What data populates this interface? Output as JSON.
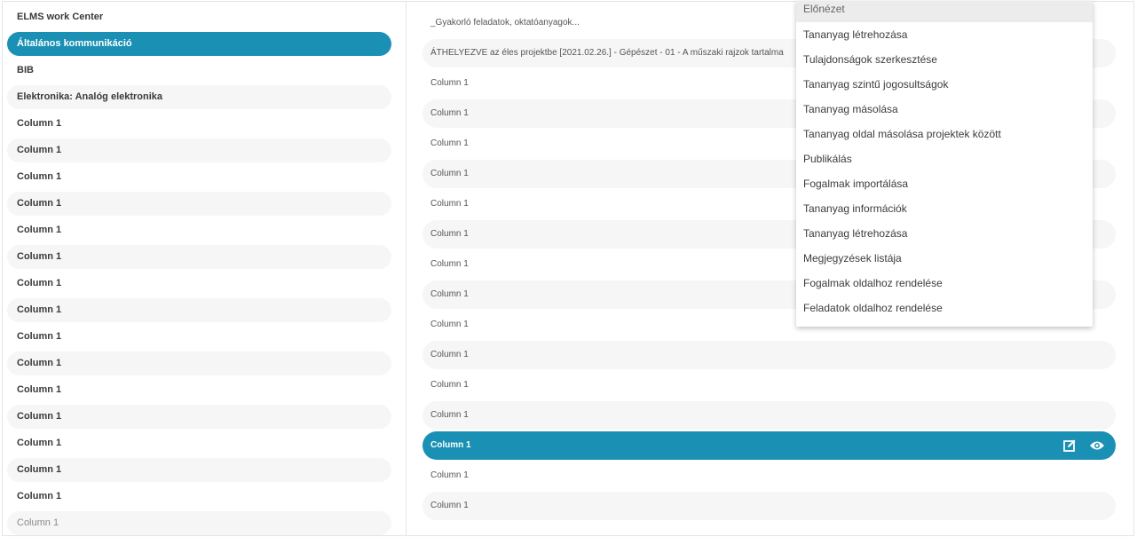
{
  "left_list": {
    "items": [
      {
        "label": "ELMS work Center",
        "style": "bold"
      },
      {
        "label": "Általános kommunikáció",
        "style": "selected"
      },
      {
        "label": "BIB",
        "style": "bold"
      },
      {
        "label": "Elektronika: Analóg elektronika",
        "style": "bold alt"
      },
      {
        "label": "Column 1",
        "style": "bold"
      },
      {
        "label": "Column 1",
        "style": "bold alt"
      },
      {
        "label": "Column 1",
        "style": "bold"
      },
      {
        "label": "Column 1",
        "style": "bold alt"
      },
      {
        "label": "Column 1",
        "style": "bold"
      },
      {
        "label": "Column 1",
        "style": "bold alt"
      },
      {
        "label": "Column 1",
        "style": "bold"
      },
      {
        "label": "Column 1",
        "style": "bold alt"
      },
      {
        "label": "Column 1",
        "style": "bold"
      },
      {
        "label": "Column 1",
        "style": "bold alt"
      },
      {
        "label": "Column 1",
        "style": "bold"
      },
      {
        "label": "Column 1",
        "style": "bold alt"
      },
      {
        "label": "Column 1",
        "style": "bold"
      },
      {
        "label": "Column 1",
        "style": "bold alt"
      },
      {
        "label": "Column 1",
        "style": "bold"
      },
      {
        "label": "Column 1",
        "style": "light alt"
      }
    ]
  },
  "right_list": {
    "items": [
      {
        "label": "_Gyakorló feladatok, oktatóanyagok...",
        "style": ""
      },
      {
        "label": "ÁTHELYEZVE az éles projektbe [2021.02.26.] - Gépészet - 01 - A műszaki rajzok tartalma",
        "style": "alt"
      },
      {
        "label": "Column 1",
        "style": ""
      },
      {
        "label": "Column 1",
        "style": "alt"
      },
      {
        "label": "Column 1",
        "style": ""
      },
      {
        "label": "Column 1",
        "style": "alt"
      },
      {
        "label": "Column 1",
        "style": ""
      },
      {
        "label": "Column 1",
        "style": "alt"
      },
      {
        "label": "Column 1",
        "style": ""
      },
      {
        "label": "Column 1",
        "style": "alt"
      },
      {
        "label": "Column 1",
        "style": ""
      },
      {
        "label": "Column 1",
        "style": "alt"
      },
      {
        "label": "Column 1",
        "style": ""
      },
      {
        "label": "Column 1",
        "style": "alt"
      },
      {
        "label": "Column 1",
        "style": "selected"
      },
      {
        "label": "Column 1",
        "style": ""
      },
      {
        "label": "Column 1",
        "style": "alt"
      }
    ],
    "selected_row_icons": [
      "edit-icon",
      "eye-icon"
    ]
  },
  "context_menu": {
    "items": [
      "Előnézet",
      "Tananyag létrehozása",
      "Tulajdonságok szerkesztése",
      "Tananyag szintű jogosultságok",
      "Tananyag másolása",
      "Tananyag oldal másolása projektek között",
      "Publikálás",
      "Fogalmak importálása",
      "Tananyag információk",
      "Tananyag létrehozása",
      "Megjegyzések listája",
      "Fogalmak oldalhoz rendelése",
      "Feladatok oldalhoz rendelése"
    ]
  },
  "colors": {
    "accent": "#1a91b4",
    "row_alt": "#f6f6f6",
    "menu_highlight": "#ececec"
  }
}
